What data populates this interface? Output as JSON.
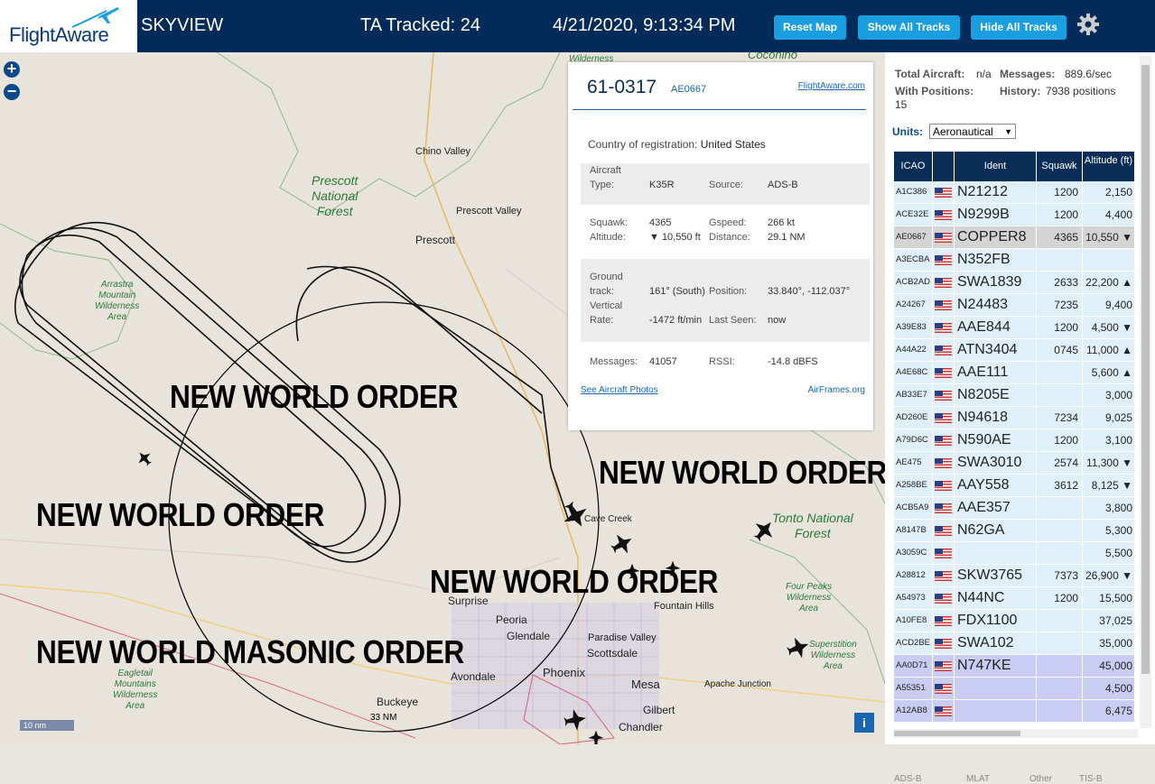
{
  "header": {
    "logo_text": "FlightAware",
    "app_name": "SKYVIEW",
    "ta_tracked": "TA Tracked: 24",
    "datetime": "4/21/2020, 9:13:34 PM",
    "buttons": [
      "Reset Map",
      "Show All Tracks",
      "Hide All Tracks"
    ],
    "settings_icon": "gear-icon",
    "colors": {
      "bar": "#032b5a",
      "button": "#1a9ee0"
    }
  },
  "map": {
    "zoom_in": "+",
    "zoom_out": "−",
    "scale_label": "10 nm",
    "range_label": "33 NM",
    "info_label": "i",
    "forests": [
      {
        "name": "Prescott\nNational\nForest"
      },
      {
        "name": "Tonto National\nForest"
      }
    ],
    "wilderness": [
      "Arrastra\nMountain\nWilderness\nArea",
      "Eagletail\nMountains\nWilderness\nArea",
      "Four Peaks\nWilderness\nArea",
      "Superstition\nWilderness\nArea"
    ],
    "cities": [
      "Chino Valley",
      "Prescott Valley",
      "Prescott",
      "Surprise",
      "Peoria",
      "Glendale",
      "Paradise Valley",
      "Scottsdale",
      "Avondale",
      "Phoenix",
      "Mesa",
      "Gilbert",
      "Chandler",
      "Buckeye",
      "Fountain Hills",
      "Apache Junction",
      "Cave Creek",
      "Coconino",
      "Wilderness"
    ],
    "overlay_texts": [
      "NEW WORLD ORDER",
      "NEW WORLD ORDER",
      "NEW WORLD ORDER",
      "NEW WORLD ORDER",
      "NEW WORLD MASONIC ORDER"
    ]
  },
  "popup": {
    "callsign": "61-0317",
    "icao": "AE0667",
    "fa_link": "FlightAware.com",
    "country_label": "Country of registration:",
    "country": "United States",
    "aircraft_type_label": "Aircraft Type:",
    "aircraft_type": "K35R",
    "source_label": "Source:",
    "source": "ADS-B",
    "squawk_label": "Squawk:",
    "squawk": "4365",
    "gspeed_label": "Gspeed:",
    "gspeed": "266 kt",
    "altitude_label": "Altitude:",
    "altitude": "▼ 10,550 ft",
    "distance_label": "Distance:",
    "distance": "29.1 NM",
    "ground_track_label": "Ground track:",
    "ground_track": "161° (South)",
    "position_label": "Position:",
    "position": "33.840°, -112.037°",
    "vrate_label": "Vertical Rate:",
    "vrate": "-1472 ft/min",
    "last_seen_label": "Last Seen:",
    "last_seen": "now",
    "messages_label": "Messages:",
    "messages": "41057",
    "rssi_label": "RSSI:",
    "rssi": "-14.8 dBFS",
    "photos_link": "See Aircraft Photos",
    "airframes_link": "AirFrames.org"
  },
  "panel": {
    "total_aircraft_label": "Total Aircraft:",
    "total_aircraft": "n/a",
    "messages_label": "Messages:",
    "messages": "889.6/sec",
    "with_positions_label": "With Positions:",
    "with_positions": "15",
    "history_label": "History:",
    "history": "7938 positions",
    "units_label": "Units:",
    "units_value": "Aeronautical",
    "columns": [
      "ICAO",
      "",
      "Ident",
      "Squawk",
      "Altitude (ft)"
    ],
    "rows": [
      {
        "icao": "A1C386",
        "ident": "N21212",
        "squawk": "1200",
        "alt": "2,150",
        "bg": "#dff0fa"
      },
      {
        "icao": "ACE32E",
        "ident": "N9299B",
        "squawk": "1200",
        "alt": "4,400",
        "bg": "#dff0fa"
      },
      {
        "icao": "AE0667",
        "ident": "COPPER8",
        "squawk": "4365",
        "alt": "10,550 ▼",
        "bg": "#d4d4d4"
      },
      {
        "icao": "A3ECBA",
        "ident": "N352FB",
        "squawk": "",
        "alt": "",
        "bg": "#dff0fa"
      },
      {
        "icao": "ACB2AD",
        "ident": "SWA1839",
        "squawk": "2633",
        "alt": "22,200 ▲",
        "bg": "#dff0fa"
      },
      {
        "icao": "A24267",
        "ident": "N24483",
        "squawk": "7235",
        "alt": "9,400",
        "bg": "#dff0fa"
      },
      {
        "icao": "A39E83",
        "ident": "AAE844",
        "squawk": "1200",
        "alt": "4,500 ▼",
        "bg": "#dff0fa"
      },
      {
        "icao": "A44A22",
        "ident": "ATN3404",
        "squawk": "0745",
        "alt": "11,000 ▲",
        "bg": "#dff0fa"
      },
      {
        "icao": "A4E68C",
        "ident": "AAE111",
        "squawk": "",
        "alt": "5,600 ▲",
        "bg": "#dff0fa"
      },
      {
        "icao": "AB33E7",
        "ident": "N8205E",
        "squawk": "",
        "alt": "3,000",
        "bg": "#dff0fa"
      },
      {
        "icao": "AD260E",
        "ident": "N94618",
        "squawk": "7234",
        "alt": "9,025",
        "bg": "#dff0fa"
      },
      {
        "icao": "A79D6C",
        "ident": "N590AE",
        "squawk": "1200",
        "alt": "3,100",
        "bg": "#dff0fa"
      },
      {
        "icao": "AE475",
        "ident": "SWA3010",
        "squawk": "2574",
        "alt": "11,300 ▼",
        "bg": "#dff0fa"
      },
      {
        "icao": "A258BE",
        "ident": "AAY558",
        "squawk": "3612",
        "alt": "8,125 ▼",
        "bg": "#dff0fa"
      },
      {
        "icao": "ACB5A9",
        "ident": "AAE357",
        "squawk": "",
        "alt": "3,800",
        "bg": "#dff0fa"
      },
      {
        "icao": "A8147B",
        "ident": "N62GA",
        "squawk": "",
        "alt": "5,300",
        "bg": "#dff0fa"
      },
      {
        "icao": "A3059C",
        "ident": "",
        "squawk": "",
        "alt": "5,500",
        "bg": "#dff0fa"
      },
      {
        "icao": "A28812",
        "ident": "SKW3765",
        "squawk": "7373",
        "alt": "26,900 ▼",
        "bg": "#dff0fa"
      },
      {
        "icao": "A54973",
        "ident": "N44NC",
        "squawk": "1200",
        "alt": "15,500",
        "bg": "#dff0fa"
      },
      {
        "icao": "A10FE8",
        "ident": "FDX1100",
        "squawk": "",
        "alt": "37,025",
        "bg": "#dff0fa"
      },
      {
        "icao": "ACD2BE",
        "ident": "SWA102",
        "squawk": "",
        "alt": "35,000",
        "bg": "#dff0fa"
      },
      {
        "icao": "AA0D71",
        "ident": "N747KE",
        "squawk": "",
        "alt": "45,000",
        "bg": "#c9cdf3"
      },
      {
        "icao": "A55351",
        "ident": "",
        "squawk": "",
        "alt": "4,500",
        "bg": "#c9cdf3"
      },
      {
        "icao": "A12AB8",
        "ident": "",
        "squawk": "",
        "alt": "6,475",
        "bg": "#c9cdf3"
      }
    ],
    "legend": [
      "ADS-B",
      "MLAT",
      "Other",
      "TIS-B"
    ]
  }
}
